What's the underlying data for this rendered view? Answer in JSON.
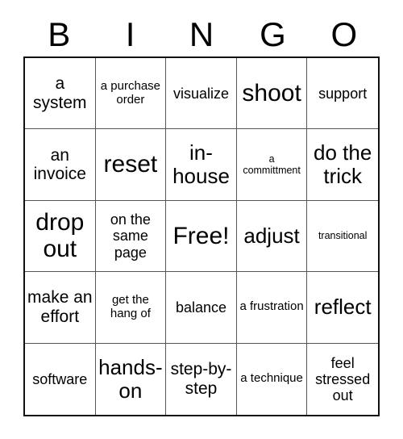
{
  "card": {
    "title_letters": [
      "B",
      "I",
      "N",
      "G",
      "O"
    ],
    "columns": 5,
    "rows": 5,
    "free_space_index": 12,
    "colors": {
      "background": "#ffffff",
      "text": "#000000",
      "outer_border": "#111111",
      "inner_border": "#555555"
    },
    "cells": [
      {
        "text": "a system",
        "size": "lg"
      },
      {
        "text": "a purchase order",
        "size": "sm"
      },
      {
        "text": "visualize",
        "size": "md"
      },
      {
        "text": "shoot",
        "size": "xxl"
      },
      {
        "text": "support",
        "size": "md"
      },
      {
        "text": "an invoice",
        "size": "lg"
      },
      {
        "text": "reset",
        "size": "xxl"
      },
      {
        "text": "in-house",
        "size": "xl"
      },
      {
        "text": "a committment",
        "size": "xs"
      },
      {
        "text": "do the trick",
        "size": "xl"
      },
      {
        "text": "drop out",
        "size": "xxl"
      },
      {
        "text": "on the same page",
        "size": "md"
      },
      {
        "text": "Free!",
        "size": "xxl"
      },
      {
        "text": "adjust",
        "size": "xl"
      },
      {
        "text": "transitional",
        "size": "xs"
      },
      {
        "text": "make an effort",
        "size": "lg"
      },
      {
        "text": "get the hang of",
        "size": "sm"
      },
      {
        "text": "balance",
        "size": "md"
      },
      {
        "text": "a frustration",
        "size": "sm"
      },
      {
        "text": "reflect",
        "size": "xl"
      },
      {
        "text": "software",
        "size": "md"
      },
      {
        "text": "hands-on",
        "size": "xl"
      },
      {
        "text": "step-by-step",
        "size": "lg"
      },
      {
        "text": "a technique",
        "size": "sm"
      },
      {
        "text": "feel stressed out",
        "size": "md"
      }
    ]
  }
}
